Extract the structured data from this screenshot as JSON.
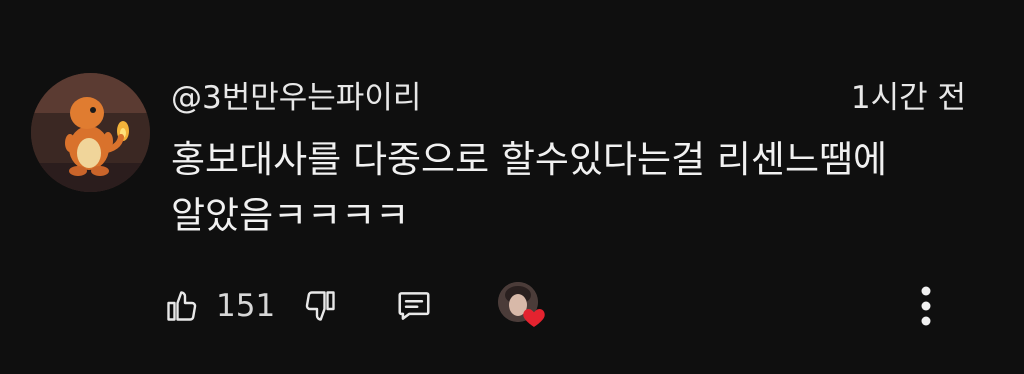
{
  "comment": {
    "author": "@3번만우는파이리",
    "timestamp": "1시간 전",
    "text": "홍보대사를 다중으로 할수있다는걸 리센느땜에 알았음ㅋㅋㅋㅋ",
    "like_count": "151",
    "hearted_by_creator": true
  },
  "icons": {
    "like": "thumbs-up-icon",
    "dislike": "thumbs-down-icon",
    "reply": "reply-icon",
    "heart": "heart-icon",
    "more": "more-vertical-icon"
  },
  "colors": {
    "background": "#0f0f0f",
    "text": "#f1f1f1",
    "secondary_text": "#d8d8d8",
    "heart": "#e4232f"
  }
}
